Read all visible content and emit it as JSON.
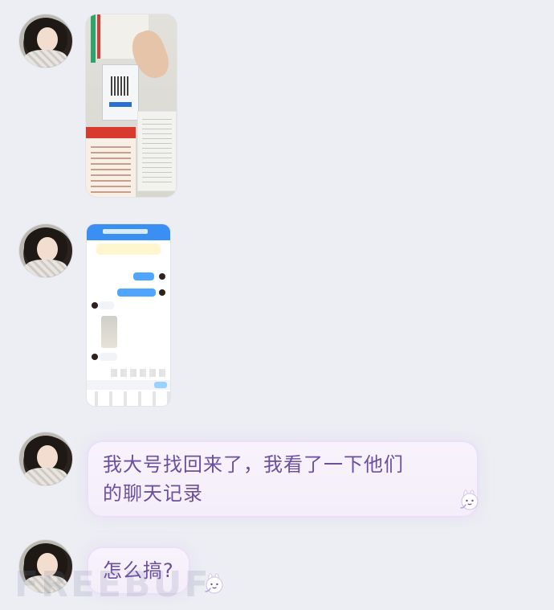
{
  "messages": [
    {
      "type": "image",
      "avatar_icon": "user-avatar-icon",
      "image_kind": "photo"
    },
    {
      "type": "image",
      "avatar_icon": "user-avatar-icon",
      "image_kind": "chat-screenshot"
    },
    {
      "type": "text",
      "avatar_icon": "user-avatar-icon",
      "text_line_1": "我大号找回来了，我看了一下他们",
      "text_line_2": "的聊天记录",
      "sticker_icon": "bunny-sticker-icon"
    },
    {
      "type": "text",
      "avatar_icon": "user-avatar-icon",
      "text": "怎么搞?",
      "sticker_icon": "bunny-sticker-icon"
    }
  ],
  "watermark": {
    "text": "FREEBUF"
  },
  "colors": {
    "background": "#eceef3",
    "bubble_text": "#6b4fa0",
    "bubble_bg": "#f6f1fb",
    "bubble_glow": "#e6d6f7",
    "watermark": "#a6b0c6"
  }
}
